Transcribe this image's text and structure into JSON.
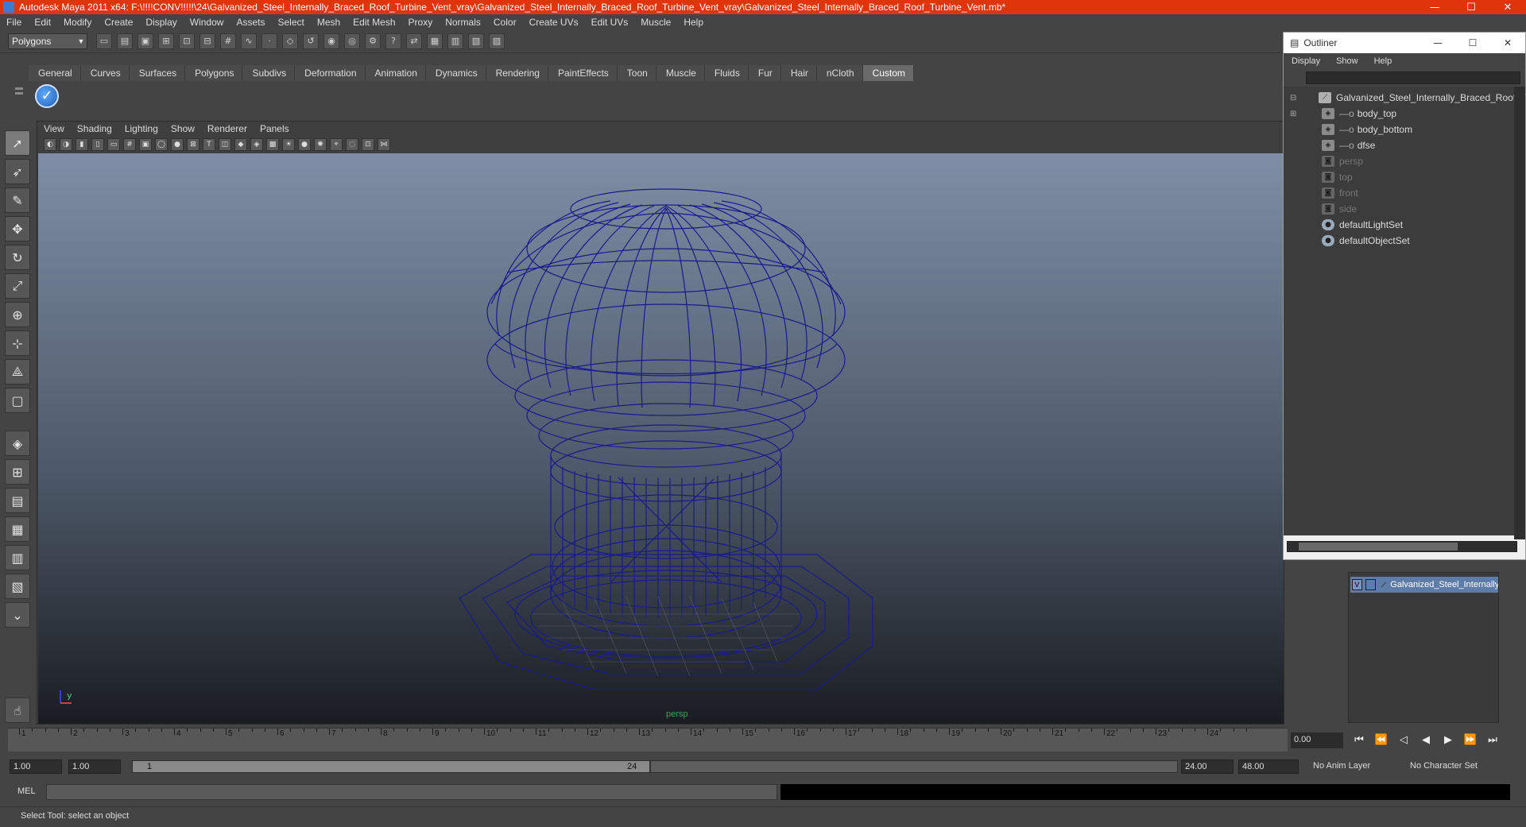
{
  "window": {
    "title": "Autodesk Maya 2011 x64: F:\\!!!!CONV!!!!!\\24\\Galvanized_Steel_Internally_Braced_Roof_Turbine_Vent_vray\\Galvanized_Steel_Internally_Braced_Roof_Turbine_Vent_vray\\Galvanized_Steel_Internally_Braced_Roof_Turbine_Vent.mb*",
    "minimize": "—",
    "maximize": "☐",
    "close": "✕"
  },
  "menubar": [
    "File",
    "Edit",
    "Modify",
    "Create",
    "Display",
    "Window",
    "Assets",
    "Select",
    "Mesh",
    "Edit Mesh",
    "Proxy",
    "Normals",
    "Color",
    "Create UVs",
    "Edit UVs",
    "Muscle",
    "Help"
  ],
  "toolbar": {
    "mode": "Polygons"
  },
  "shelf": {
    "tabs": [
      "General",
      "Curves",
      "Surfaces",
      "Polygons",
      "Subdivs",
      "Deformation",
      "Animation",
      "Dynamics",
      "Rendering",
      "PaintEffects",
      "Toon",
      "Muscle",
      "Fluids",
      "Fur",
      "Hair",
      "nCloth",
      "Custom"
    ],
    "active_tab": "Custom"
  },
  "panel": {
    "menu": [
      "View",
      "Shading",
      "Lighting",
      "Show",
      "Renderer",
      "Panels"
    ],
    "camera_label": "persp",
    "axis_y": "y",
    "axis_x": "x"
  },
  "outliner": {
    "title": "Outliner",
    "menu": [
      "Display",
      "Show",
      "Help"
    ],
    "items": [
      {
        "label": "Galvanized_Steel_Internally_Braced_Roof_Tu",
        "dim": false,
        "indent": 0
      },
      {
        "label": "body_top",
        "dim": false,
        "indent": 1
      },
      {
        "label": "body_bottom",
        "dim": false,
        "indent": 1
      },
      {
        "label": "dfse",
        "dim": false,
        "indent": 1
      },
      {
        "label": "persp",
        "dim": true,
        "indent": 0
      },
      {
        "label": "top",
        "dim": true,
        "indent": 0
      },
      {
        "label": "front",
        "dim": true,
        "indent": 0
      },
      {
        "label": "side",
        "dim": true,
        "indent": 0
      },
      {
        "label": "defaultLightSet",
        "dim": false,
        "indent": 0
      },
      {
        "label": "defaultObjectSet",
        "dim": false,
        "indent": 0
      }
    ]
  },
  "layers": {
    "row_label": "Galvanized_Steel_Internally_B",
    "visible_flag": "V"
  },
  "timeline": {
    "ticks": [
      "1",
      "2",
      "3",
      "4",
      "5",
      "6",
      "7",
      "8",
      "9",
      "10",
      "11",
      "12",
      "13",
      "14",
      "15",
      "16",
      "17",
      "18",
      "19",
      "20",
      "21",
      "22",
      "23",
      "24"
    ],
    "current_time": "0.00"
  },
  "range": {
    "start_time": "1.00",
    "playback_start": "1.00",
    "slider_start": "1",
    "slider_end": "24",
    "playback_end": "24.00",
    "end_time": "48.00",
    "anim_layer": "No Anim Layer",
    "character_set": "No Character Set"
  },
  "command": {
    "label": "MEL"
  },
  "help_line": "Select Tool: select an object",
  "colors": {
    "title_bar": "#e0350b",
    "wireframe": "#1a1a8c",
    "active_tab": "#6a6a6a"
  }
}
